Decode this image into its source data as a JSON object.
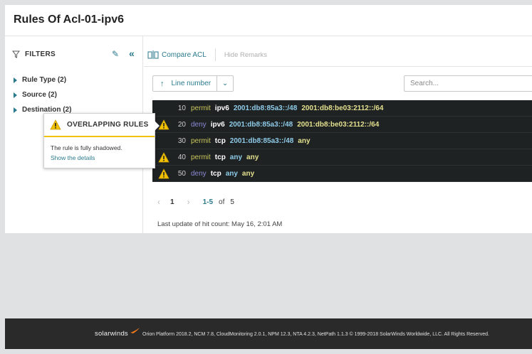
{
  "page": {
    "title": "Rules Of Acl-01-ipv6"
  },
  "sidebar": {
    "filters_label": "FILTERS",
    "items": [
      {
        "label": "Rule Type (2)"
      },
      {
        "label": "Source (2)"
      },
      {
        "label": "Destination (2)"
      }
    ]
  },
  "toolbar": {
    "compare_label": "Compare ACL",
    "hide_remarks_label": "Hide Remarks"
  },
  "sort": {
    "label": "Line number"
  },
  "search": {
    "placeholder": "Search..."
  },
  "rules": [
    {
      "line": "10",
      "warning": false,
      "action": "permit",
      "protocol": "ipv6",
      "source": "2001:db8:85a3::/48",
      "destination": "2001:db8:be03:2112::/64"
    },
    {
      "line": "20",
      "warning": true,
      "action": "deny",
      "protocol": "ipv6",
      "source": "2001:db8:85a3::/48",
      "destination": "2001:db8:be03:2112::/64"
    },
    {
      "line": "30",
      "warning": false,
      "action": "permit",
      "protocol": "tcp",
      "source": "2001:db8:85a3::/48",
      "destination": "any"
    },
    {
      "line": "40",
      "warning": true,
      "action": "permit",
      "protocol": "tcp",
      "source": "any",
      "destination": "any"
    },
    {
      "line": "50",
      "warning": true,
      "action": "deny",
      "protocol": "tcp",
      "source": "any",
      "destination": "any"
    }
  ],
  "pagination": {
    "current": "1",
    "range": "1-5",
    "of_label": "of",
    "total": "5"
  },
  "last_update": "Last update of hit count: May 16, 2:01 AM",
  "tooltip": {
    "title": "OVERLAPPING RULES",
    "message": "The rule is fully shadowed.",
    "link": "Show the details"
  },
  "footer": {
    "brand": "solarwinds",
    "copyright": "Orion Platform 2018.2, NCM 7.8, CloudMonitoring 2.0.1, NPM 12.3, NTA 4.2.3, NetPath 1.1.3 © 1999-2018 SolarWinds Worldwide, LLC. All Rights Reserved."
  },
  "colors": {
    "accent": "#2a7a8c",
    "warning": "#f2c200",
    "table_bg": "#1f2223",
    "footer_bg": "#2a2a2a"
  }
}
